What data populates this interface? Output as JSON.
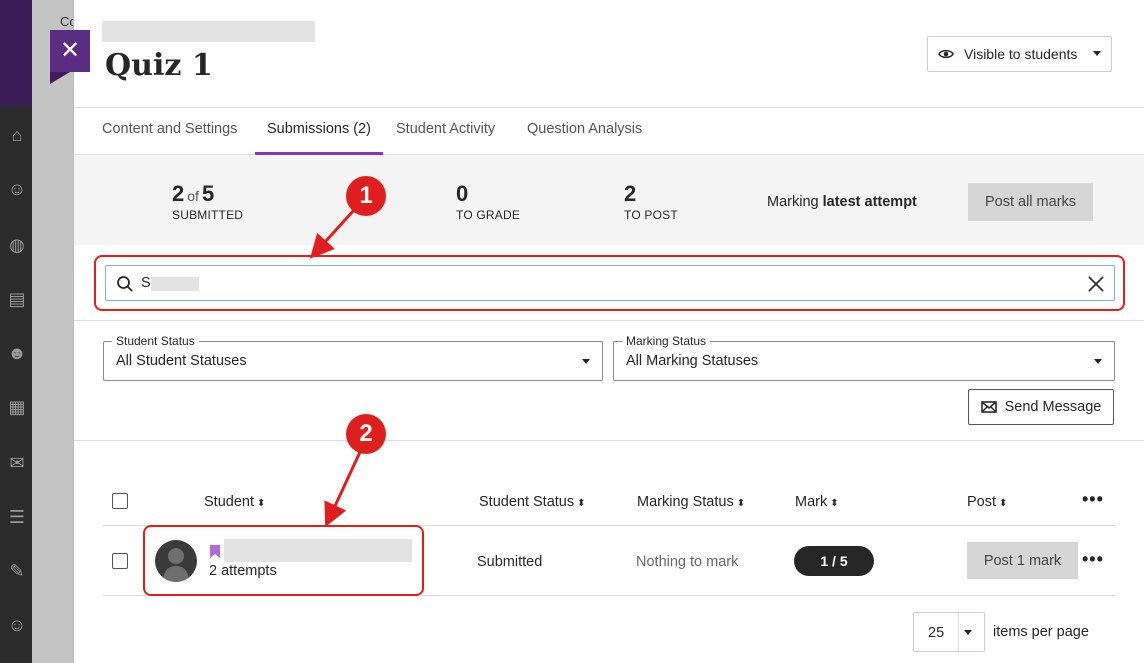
{
  "background": {
    "partial_text": "Co"
  },
  "panel": {
    "title": "Quiz 1",
    "visibility_label": "Visible to students"
  },
  "tabs": [
    {
      "label": "Content and Settings"
    },
    {
      "label": "Submissions (2)"
    },
    {
      "label": "Student Activity"
    },
    {
      "label": "Question Analysis"
    }
  ],
  "stats": {
    "submitted_num": "2",
    "submitted_of": "of",
    "submitted_total": "5",
    "submitted_label": "SUBMITTED",
    "to_grade_num": "0",
    "to_grade_label": "TO GRADE",
    "to_post_num": "2",
    "to_post_label": "TO POST",
    "marking_prefix": "Marking",
    "marking_value": "latest attempt",
    "post_all_label": "Post all marks"
  },
  "search": {
    "value": "S"
  },
  "filters": {
    "student_status_label": "Student Status",
    "student_status_value": "All Student Statuses",
    "marking_status_label": "Marking Status",
    "marking_status_value": "All Marking Statuses"
  },
  "send_message_label": "Send Message",
  "table": {
    "headers": {
      "student": "Student",
      "student_status": "Student Status",
      "marking_status": "Marking Status",
      "mark": "Mark",
      "post": "Post",
      "sort_glyph": "⬍"
    },
    "rows": [
      {
        "attempts": "2 attempts",
        "student_status": "Submitted",
        "marking_status": "Nothing to mark",
        "mark": "1 / 5",
        "post_label": "Post 1 mark"
      }
    ]
  },
  "pagination": {
    "page_size": "25",
    "items_per_page_label": "items per page"
  },
  "annotations": {
    "one": "1",
    "two": "2",
    "color": "#e01e1e"
  },
  "colors": {
    "accent_purple": "#5a2d82",
    "tab_underline": "#8b34b4",
    "bookmark": "#b368d6"
  }
}
